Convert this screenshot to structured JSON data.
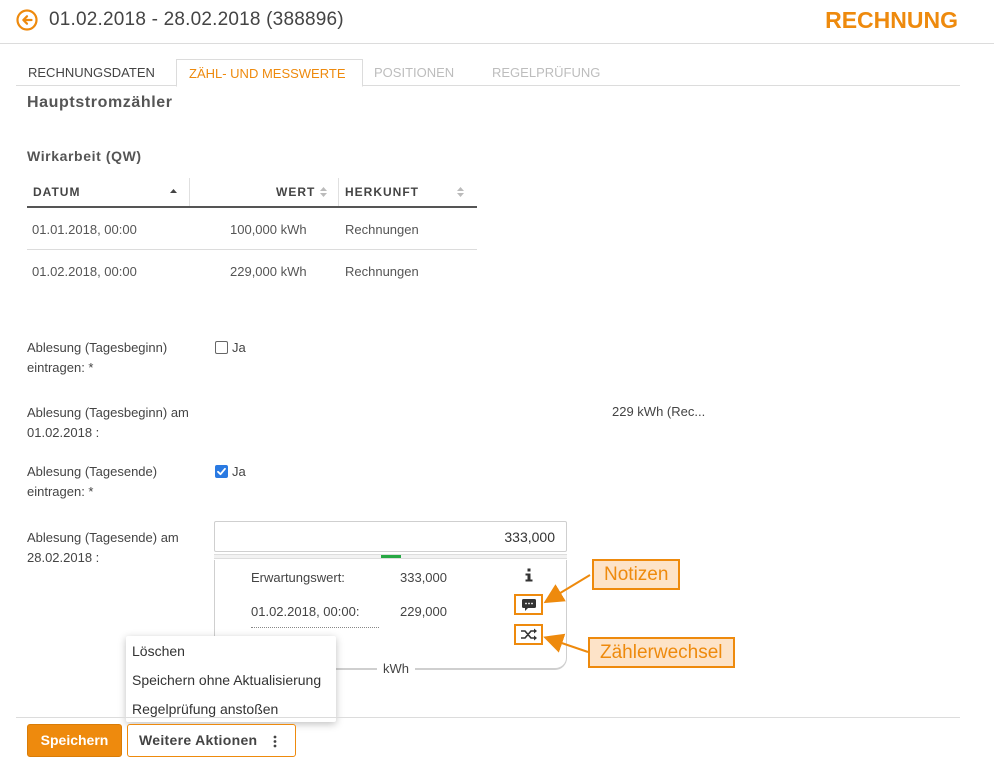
{
  "header": {
    "title": "01.02.2018 - 28.02.2018 (388896)",
    "doc_type": "RECHNUNG",
    "back_icon": "arrow-left-circle-icon",
    "accent_color": "#ee8a0d"
  },
  "tabs": [
    {
      "label": "RECHNUNGSDATEN",
      "state": "normal"
    },
    {
      "label": "ZÄHL- UND MESSWERTE",
      "state": "active"
    },
    {
      "label": "POSITIONEN",
      "state": "disabled"
    },
    {
      "label": "REGELPRÜFUNG",
      "state": "disabled"
    }
  ],
  "section": {
    "title": "Hauptstromzähler",
    "subtitle": "Wirkarbeit (QW)"
  },
  "table": {
    "columns": [
      "DATUM",
      "WERT",
      "HERKUNFT"
    ],
    "rows": [
      {
        "datum": "01.01.2018, 00:00",
        "wert": "100,000 kWh",
        "herkunft": "Rechnungen"
      },
      {
        "datum": "01.02.2018, 00:00",
        "wert": "229,000 kWh",
        "herkunft": "Rechnungen"
      }
    ]
  },
  "fields": {
    "start_entry_label": "Ablesung (Tagesbeginn) eintragen: *",
    "start_entry_checkbox_label": "Ja",
    "start_entry_checked": false,
    "start_reading_label": "Ablesung (Tagesbeginn) am 01.02.2018 :",
    "start_reading_value": "229  kWh (Rec...",
    "end_entry_label": "Ablesung (Tagesende) eintragen: *",
    "end_entry_checkbox_label": "Ja",
    "end_entry_checked": true,
    "end_reading_label": "Ablesung (Tagesende) am 28.02.2018 :",
    "end_reading_value": "333,000",
    "progress_fraction": 0.5
  },
  "reading_panel": {
    "expected_label": "Erwartungswert:",
    "expected_value": "333,000",
    "previous_date": "01.02.2018, 00:00:",
    "previous_value": "229,000",
    "unit": "kWh",
    "notes_icon": "comment-icon",
    "meter_change_icon": "shuffle-icon",
    "info_icon": "info-icon"
  },
  "callouts": {
    "notes": "Notizen",
    "meter_change": "Zählerwechsel"
  },
  "dropdown": {
    "items": [
      "Löschen",
      "Speichern ohne Aktualisierung",
      "Regelprüfung anstoßen"
    ]
  },
  "actions": {
    "save_label": "Speichern",
    "more_label": "Weitere Aktionen"
  }
}
